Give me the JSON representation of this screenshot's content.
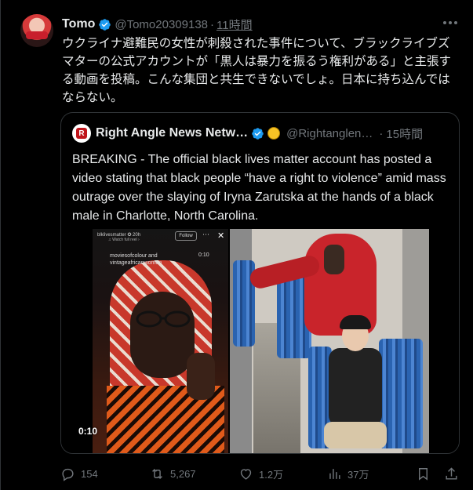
{
  "author": {
    "name": "Tomo",
    "handle": "@Tomo20309138",
    "separator": "·",
    "time": "11時間",
    "avatar_icon": "user-avatar-icon",
    "verified_color": "#1d9bf0"
  },
  "tweet_text": "ウクライナ避難民の女性が刺殺された事件について、ブラックライブズマターの公式アカウントが「黒人は暴力を振るう権利がある」と主張する動画を投稿。こんな集団と共生できないでしょ。日本に持ち込んではならない。",
  "quote": {
    "name": "Right Angle News Netw…",
    "handle": "@Rightanglen…",
    "separator": "·",
    "time": "15時間",
    "avatar_letter": "R",
    "text": "BREAKING - The official black lives matter account has posted a video stating that black people “have a right to violence” amid mass outrage over the slaying of Iryna Zarutska at the hands of a black male in Charlotte, North Carolina.",
    "media": {
      "ig_account": "blklivesmatter ✪ 20h",
      "ig_sub": "♫ Watch full reel ›",
      "ig_follow": "Follow",
      "ig_caption_line1": "moviesofcolour and",
      "ig_caption_line2": "vintageafricanwomen",
      "ig_timer": "0:10",
      "video_duration": "0:10"
    }
  },
  "actions": {
    "replies": "154",
    "reposts": "5,267",
    "likes": "1.2万",
    "views": "37万"
  },
  "colors": {
    "background": "#000000",
    "text": "#e7e9ea",
    "secondary": "#71767b",
    "border": "#2f3336",
    "accent": "#1d9bf0"
  }
}
